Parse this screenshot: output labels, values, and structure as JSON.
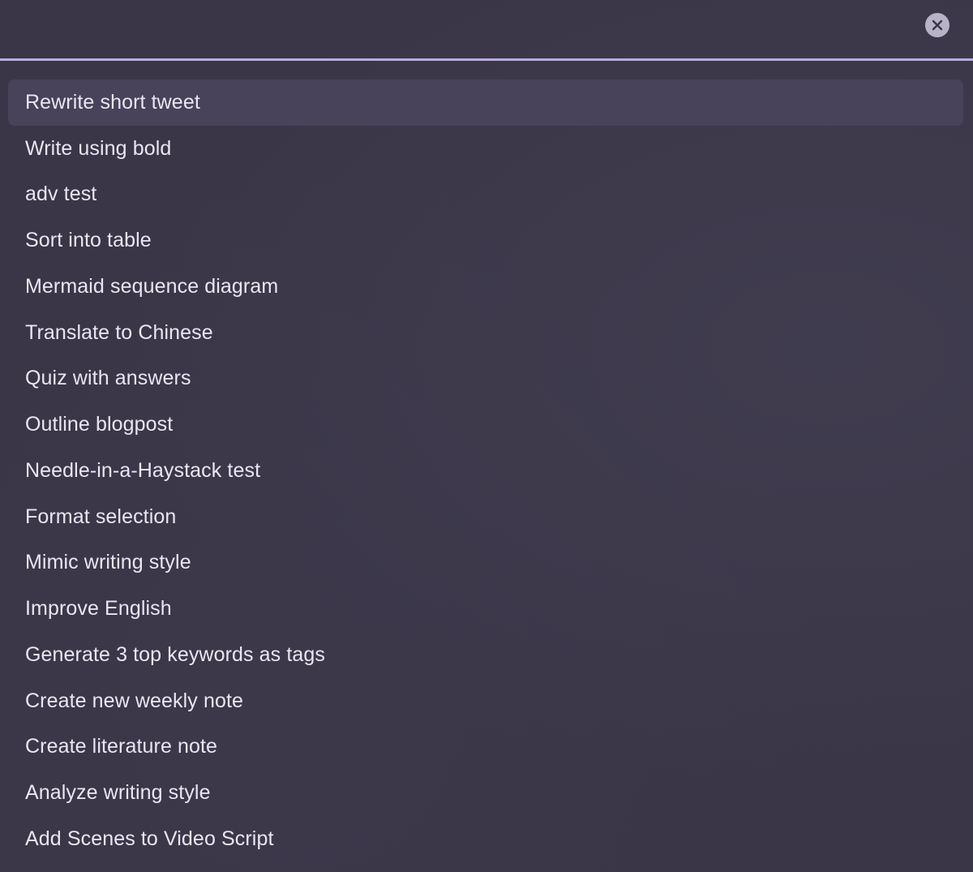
{
  "search": {
    "value": "",
    "placeholder": ""
  },
  "clear_button": {
    "icon": "close-icon"
  },
  "colors": {
    "background": "#3a3647",
    "selected_row": "#48435a",
    "divider": "#b9acdc",
    "text": "#e9e6f2",
    "clear_button": "#b8b3c6"
  },
  "list": {
    "selected_index": 0,
    "items": [
      {
        "label": "Rewrite short tweet"
      },
      {
        "label": "Write using bold"
      },
      {
        "label": "adv test"
      },
      {
        "label": "Sort into table"
      },
      {
        "label": "Mermaid sequence diagram"
      },
      {
        "label": "Translate to Chinese"
      },
      {
        "label": "Quiz with answers"
      },
      {
        "label": "Outline blogpost"
      },
      {
        "label": "Needle-in-a-Haystack test"
      },
      {
        "label": "Format selection"
      },
      {
        "label": "Mimic writing style"
      },
      {
        "label": "Improve English"
      },
      {
        "label": "Generate 3 top keywords as tags"
      },
      {
        "label": "Create new weekly note"
      },
      {
        "label": "Create literature note"
      },
      {
        "label": "Analyze writing style"
      },
      {
        "label": "Add Scenes to Video Script"
      }
    ]
  }
}
